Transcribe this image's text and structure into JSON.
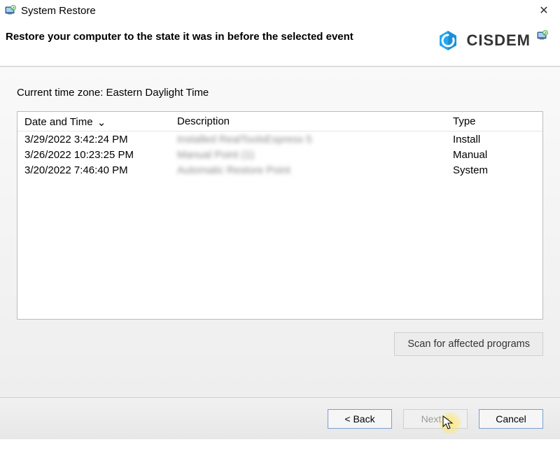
{
  "window": {
    "title": "System Restore",
    "close_glyph": "✕"
  },
  "header": {
    "instruction": "Restore your computer to the state it was in before the selected event",
    "brand": "CISDEM"
  },
  "timezone": {
    "label": "Current time zone: Eastern Daylight Time"
  },
  "table": {
    "columns": {
      "date_time": "Date and Time",
      "description": "Description",
      "type": "Type"
    },
    "sort_chevron": "⌄",
    "rows": [
      {
        "datetime": "3/29/2022 3:42:24 PM",
        "description": "Installed RealToolsExpress 5",
        "type": "Install"
      },
      {
        "datetime": "3/26/2022 10:23:25 PM",
        "description": "Manual Point (1)",
        "type": "Manual"
      },
      {
        "datetime": "3/20/2022 7:46:40 PM",
        "description": "Automatic Restore Point",
        "type": "System"
      }
    ]
  },
  "buttons": {
    "scan": "Scan for affected programs",
    "back": "< Back",
    "next": "Next >",
    "cancel": "Cancel"
  }
}
